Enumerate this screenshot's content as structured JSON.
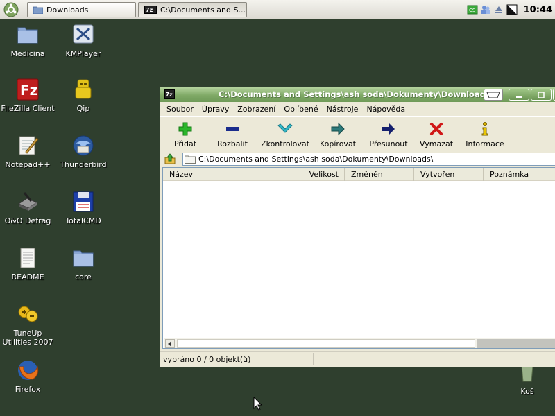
{
  "taskbar": {
    "tasks": [
      {
        "label": "Downloads"
      },
      {
        "label": "C:\\Documents and S..."
      }
    ],
    "clock": "10:44"
  },
  "desktop": {
    "icons": [
      {
        "label": "Medicina",
        "icon": "folder-icon"
      },
      {
        "label": "KMPlayer",
        "icon": "kmplayer-icon"
      },
      {
        "label": "FileZilla Client",
        "icon": "filezilla-icon"
      },
      {
        "label": "Qip",
        "icon": "qip-icon"
      },
      {
        "label": "Notepad++",
        "icon": "notepad-icon"
      },
      {
        "label": "Thunderbird",
        "icon": "thunderbird-icon"
      },
      {
        "label": "O&O Defrag",
        "icon": "defrag-icon"
      },
      {
        "label": "TotalCMD",
        "icon": "floppy-icon"
      },
      {
        "label": "README",
        "icon": "document-icon"
      },
      {
        "label": "core",
        "icon": "folder-icon"
      },
      {
        "label": "TuneUp Utilities 2007",
        "icon": "tuneup-icon"
      },
      {
        "label": "Firefox",
        "icon": "firefox-icon"
      },
      {
        "label": "Koš",
        "icon": "recycle-bin-icon"
      }
    ]
  },
  "window": {
    "title": "C:\\Documents and Settings\\ash soda\\Dokumenty\\Downloads\\",
    "menu": [
      "Soubor",
      "Úpravy",
      "Zobrazení",
      "Oblíbené",
      "Nástroje",
      "Nápověda"
    ],
    "toolbar": [
      {
        "label": "Přidat",
        "icon": "add-icon",
        "color": "#2bb52b"
      },
      {
        "label": "Rozbalit",
        "icon": "extract-icon",
        "color": "#1a2c8c"
      },
      {
        "label": "Zkontrolovat",
        "icon": "test-icon",
        "color": "#33b8c8"
      },
      {
        "label": "Kopírovat",
        "icon": "copy-icon",
        "color": "#2d7a7a"
      },
      {
        "label": "Přesunout",
        "icon": "move-icon",
        "color": "#15206e"
      },
      {
        "label": "Vymazat",
        "icon": "delete-icon",
        "color": "#d01818"
      },
      {
        "label": "Informace",
        "icon": "info-icon",
        "color": "#d8b000"
      }
    ],
    "address": "C:\\Documents and Settings\\ash soda\\Dokumenty\\Downloads\\",
    "columns": [
      "Název",
      "Velikost",
      "Změněn",
      "Vytvořen",
      "Poznámka"
    ],
    "status": "vybráno 0 / 0 objekt(ů)"
  },
  "colors": {
    "desktop": "#2f3f2e",
    "titlebar": "#7fa966",
    "window_bg": "#ece9d8"
  }
}
